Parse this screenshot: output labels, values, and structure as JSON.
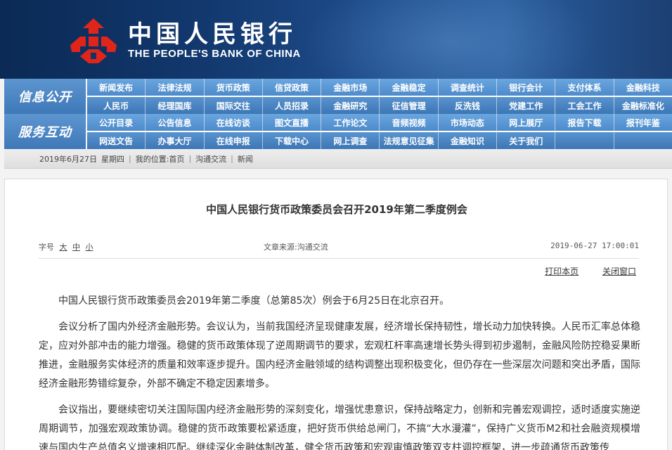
{
  "header": {
    "bank_name_cn": "中国人民银行",
    "bank_name_en": "THE PEOPLE'S BANK OF CHINA",
    "logo_icon": "pboc-logo-icon",
    "brand_red": "#e1251b"
  },
  "nav": {
    "sections": [
      {
        "label": "信息公开",
        "rows": [
          [
            "新闻发布",
            "法律法规",
            "货币政策",
            "信贷政策",
            "金融市场",
            "金融稳定",
            "调查统计",
            "银行会计",
            "支付体系",
            "金融科技"
          ],
          [
            "人民币",
            "经理国库",
            "国际交往",
            "人员招录",
            "金融研究",
            "征信管理",
            "反洗钱",
            "党建工作",
            "工会工作",
            "金融标准化"
          ]
        ]
      },
      {
        "label": "服务互动",
        "rows": [
          [
            "公开目录",
            "公告信息",
            "在线访谈",
            "图文直播",
            "工作论文",
            "音频视频",
            "市场动态",
            "网上展厅",
            "报告下载",
            "报刊年鉴"
          ],
          [
            "网送文告",
            "办事大厅",
            "在线申报",
            "下载中心",
            "网上调查",
            "法规意见征集",
            "金融知识",
            "关于我们"
          ]
        ]
      }
    ]
  },
  "breadcrumb": {
    "date": "2019年6月27日",
    "weekday": "星期四",
    "location_label": "我的位置:首页",
    "level2": "沟通交流",
    "level3": "新闻"
  },
  "article": {
    "title": "中国人民银行货币政策委员会召开2019年第二季度例会",
    "font_size_label": "字号",
    "size_large": "大",
    "size_medium": "中",
    "size_small": "小",
    "source": "文章来源:沟通交流",
    "datetime": "2019-06-27 17:00:01",
    "print_label": "打印本页",
    "close_label": "关闭窗口",
    "paragraphs": [
      "中国人民银行货币政策委员会2019年第二季度（总第85次）例会于6月25日在北京召开。",
      "会议分析了国内外经济金融形势。会议认为，当前我国经济呈现健康发展，经济增长保持韧性，增长动力加快转换。人民币汇率总体稳定，应对外部冲击的能力增强。稳健的货币政策体现了逆周期调节的要求，宏观杠杆率高速增长势头得到初步遏制，金融风险防控稳妥果断推进，金融服务实体经济的质量和效率逐步提升。国内经济金融领域的结构调整出现积极变化，但仍存在一些深层次问题和突出矛盾，国际经济金融形势错综复杂，外部不确定不稳定因素增多。",
      "会议指出，要继续密切关注国际国内经济金融形势的深刻变化，增强忧患意识，保持战略定力，创新和完善宏观调控，适时适度实施逆周期调节，加强宏观政策协调。稳健的货币政策要松紧适度，把好货币供给总闸门，不搞“大水漫灌”，保持广义货币M2和社会融资规模增速与国内生产总值名义增速相匹配。继续深化金融体制改革，健全货币政策和宏观审慎政策双支柱调控框架，进一步疏通货币政策传"
    ]
  }
}
